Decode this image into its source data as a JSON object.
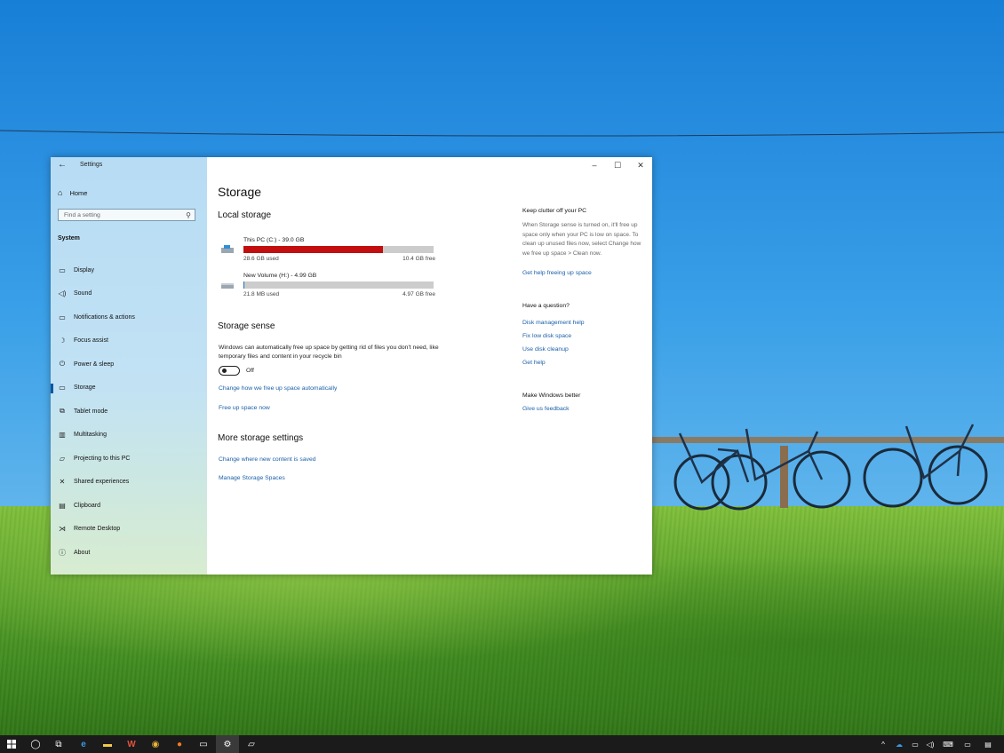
{
  "window": {
    "app_title": "Settings",
    "controls": {
      "minimize": "–",
      "maximize": "☐",
      "close": "✕"
    }
  },
  "sidebar": {
    "home_label": "Home",
    "search_placeholder": "Find a setting",
    "section_label": "System",
    "items": [
      {
        "label": "Display",
        "icon": "display-icon",
        "glyph": "▭"
      },
      {
        "label": "Sound",
        "icon": "speaker-icon",
        "glyph": "◁)"
      },
      {
        "label": "Notifications & actions",
        "icon": "notification-icon",
        "glyph": "▭"
      },
      {
        "label": "Focus assist",
        "icon": "moon-icon",
        "glyph": "☽"
      },
      {
        "label": "Power & sleep",
        "icon": "power-icon",
        "glyph": "⏻"
      },
      {
        "label": "Storage",
        "icon": "storage-icon",
        "glyph": "▭",
        "active": true
      },
      {
        "label": "Tablet mode",
        "icon": "tablet-mode-icon",
        "glyph": "⧉"
      },
      {
        "label": "Multitasking",
        "icon": "multitasking-icon",
        "glyph": "▥"
      },
      {
        "label": "Projecting to this PC",
        "icon": "projecting-icon",
        "glyph": "▱"
      },
      {
        "label": "Shared experiences",
        "icon": "shared-experiences-icon",
        "glyph": "✕"
      },
      {
        "label": "Clipboard",
        "icon": "clipboard-icon",
        "glyph": "▤"
      },
      {
        "label": "Remote Desktop",
        "icon": "remote-desktop-icon",
        "glyph": "⋊"
      },
      {
        "label": "About",
        "icon": "info-icon",
        "glyph": "ⓘ"
      }
    ]
  },
  "main": {
    "title": "Storage",
    "local_storage": {
      "heading": "Local storage",
      "drives": [
        {
          "name": "This PC (C:) - 39.0 GB",
          "used": "28.6 GB used",
          "free": "10.4 GB free",
          "used_fraction": 0.733,
          "bar_color": "#c20e0e"
        },
        {
          "name": "New Volume (H:) - 4.99 GB",
          "used": "21.8 MB used",
          "free": "4.97 GB free",
          "used_fraction": 0.004,
          "bar_color": "#2a6ebb"
        }
      ]
    },
    "storage_sense": {
      "heading": "Storage sense",
      "description": "Windows can automatically free up space by getting rid of files you don't need, like temporary files and content in your recycle bin",
      "toggle_state": "Off",
      "link_change": "Change how we free up space automatically",
      "link_free": "Free up space now"
    },
    "more": {
      "heading": "More storage settings",
      "link_content": "Change where new content is saved",
      "link_spaces": "Manage Storage Spaces"
    }
  },
  "right": {
    "clutter_heading": "Keep clutter off your PC",
    "clutter_text": "When Storage sense is turned on, it'll free up space only when your PC is low on space. To clean up unused files now, select Change how we free up space > Clean now.",
    "clutter_link": "Get help freeing up space",
    "question_heading": "Have a question?",
    "question_links": [
      "Disk management help",
      "Fix low disk space",
      "Use disk cleanup",
      "Get help"
    ],
    "better_heading": "Make Windows better",
    "better_link": "Give us feedback"
  },
  "colors": {
    "accent": "#0a57a3",
    "link": "#1a5fa8",
    "used_bar": "#c20e0e"
  }
}
